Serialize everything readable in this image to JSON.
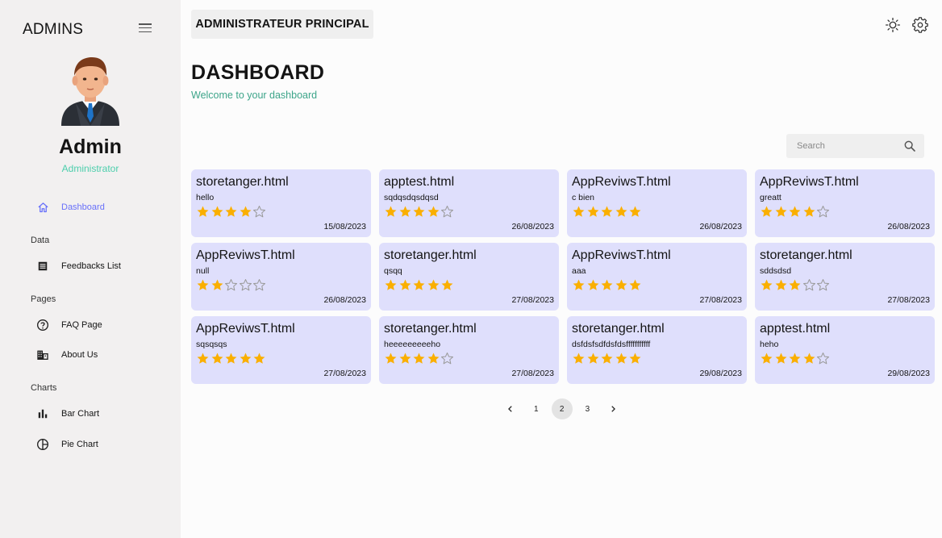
{
  "sidebar": {
    "brand": "ADMINS",
    "profile": {
      "name": "Admin",
      "role": "Administrator"
    },
    "nav": {
      "dashboard": "Dashboard",
      "section_data": "Data",
      "feedbacks": "Feedbacks List",
      "section_pages": "Pages",
      "faq": "FAQ Page",
      "about": "About Us",
      "section_charts": "Charts",
      "bar_chart": "Bar Chart",
      "pie_chart": "Pie Chart"
    }
  },
  "header": {
    "role_label": "ADMINISTRATEUR PRINCIPAL",
    "theme_icon": "sun-icon",
    "settings_icon": "gear-icon"
  },
  "page": {
    "title": "DASHBOARD",
    "subtitle": "Welcome to your dashboard"
  },
  "search": {
    "placeholder": "Search",
    "value": ""
  },
  "feedbacks": [
    {
      "title": "storetanger.html",
      "text": "hello",
      "rating": 4,
      "date": "15/08/2023"
    },
    {
      "title": "apptest.html",
      "text": "sqdqsdqsdqsd",
      "rating": 4,
      "date": "26/08/2023"
    },
    {
      "title": "AppReviwsT.html",
      "text": "c bien",
      "rating": 5,
      "date": "26/08/2023"
    },
    {
      "title": "AppReviwsT.html",
      "text": "greatt",
      "rating": 4,
      "date": "26/08/2023"
    },
    {
      "title": "AppReviwsT.html",
      "text": "null",
      "rating": 2,
      "date": "26/08/2023"
    },
    {
      "title": "storetanger.html",
      "text": "qsqq",
      "rating": 5,
      "date": "27/08/2023"
    },
    {
      "title": "AppReviwsT.html",
      "text": "aaa",
      "rating": 5,
      "date": "27/08/2023"
    },
    {
      "title": "storetanger.html",
      "text": "sddsdsd",
      "rating": 3,
      "date": "27/08/2023"
    },
    {
      "title": "AppReviwsT.html",
      "text": "sqsqsqs",
      "rating": 5,
      "date": "27/08/2023"
    },
    {
      "title": "storetanger.html",
      "text": "heeeeeeeeeho",
      "rating": 4,
      "date": "27/08/2023"
    },
    {
      "title": "storetanger.html",
      "text": "dsfdsfsdfdsfdsfffffffffff",
      "rating": 5,
      "date": "29/08/2023"
    },
    {
      "title": "apptest.html",
      "text": "heho",
      "rating": 4,
      "date": "29/08/2023"
    }
  ],
  "rating_max": 5,
  "colors": {
    "star": "#faaf00",
    "star_empty": "#9a9a9a",
    "card_bg": "#dfdffc",
    "accent": "#6870fa",
    "subtitle": "#3da58a",
    "role": "#4cceac"
  },
  "pagination": {
    "pages": [
      "1",
      "2",
      "3"
    ],
    "current": "2",
    "prev_icon": "chevron-left-icon",
    "next_icon": "chevron-right-icon"
  }
}
